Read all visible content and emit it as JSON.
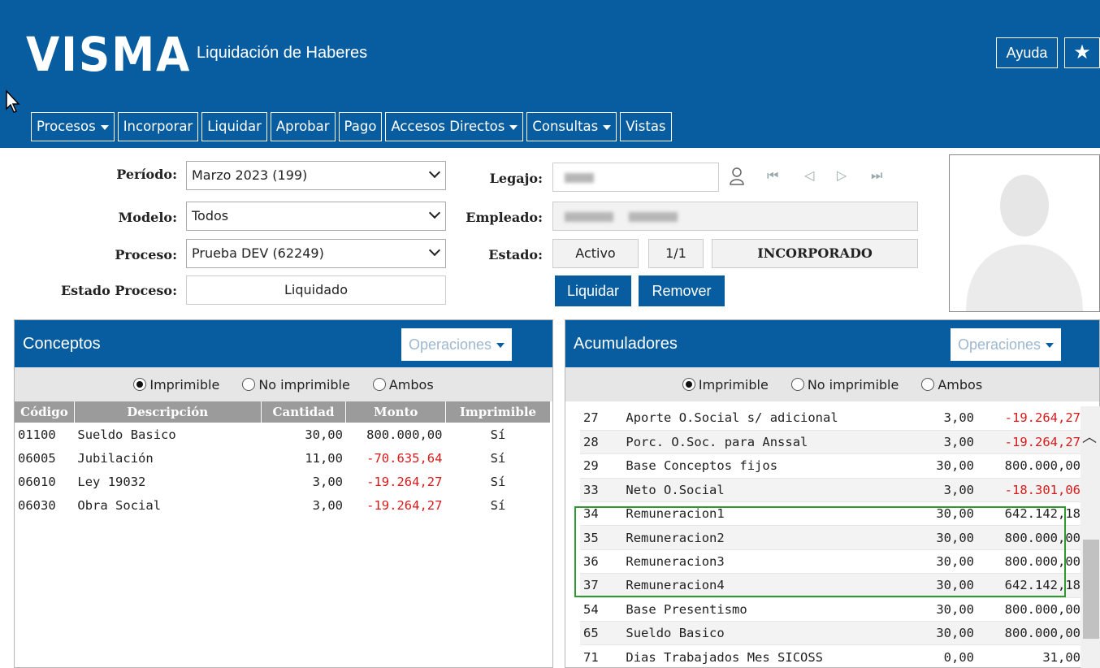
{
  "header": {
    "logo": "VISMA",
    "title": "Liquidación de Haberes",
    "help_label": "Ayuda",
    "star_icon": "★"
  },
  "menu": [
    {
      "label": "Procesos",
      "dropdown": true
    },
    {
      "label": "Incorporar",
      "dropdown": false
    },
    {
      "label": "Liquidar",
      "dropdown": false
    },
    {
      "label": "Aprobar",
      "dropdown": false
    },
    {
      "label": "Pago",
      "dropdown": false
    },
    {
      "label": "Accesos Directos",
      "dropdown": true
    },
    {
      "label": "Consultas",
      "dropdown": true
    },
    {
      "label": "Vistas",
      "dropdown": false
    }
  ],
  "form": {
    "periodo_label": "Período:",
    "periodo_value": "Marzo 2023 (199)",
    "modelo_label": "Modelo:",
    "modelo_value": "Todos",
    "proceso_label": "Proceso:",
    "proceso_value": "Prueba DEV (62249)",
    "estado_proceso_label": "Estado Proceso:",
    "estado_proceso_value": "Liquidado",
    "legajo_label": "Legajo:",
    "empleado_label": "Empleado:",
    "estado_label": "Estado:",
    "estado_value": "Activo",
    "estado_count": "1/1",
    "estado_status": "INCORPORADO",
    "liquidar_label": "Liquidar",
    "remover_label": "Remover"
  },
  "conceptos": {
    "title": "Conceptos",
    "operaciones_label": "Operaciones",
    "radios": [
      "Imprimible",
      "No imprimible",
      "Ambos"
    ],
    "selected_radio": "Imprimible",
    "columns": [
      "Código",
      "Descripción",
      "Cantidad",
      "Monto",
      "Imprimible"
    ],
    "rows": [
      {
        "code": "01100",
        "desc": "Sueldo Basico",
        "cant": "30,00",
        "monto": "800.000,00",
        "imp": "Sí"
      },
      {
        "code": "06005",
        "desc": "Jubilación",
        "cant": "11,00",
        "monto": "-70.635,64",
        "imp": "Sí"
      },
      {
        "code": "06010",
        "desc": "Ley 19032",
        "cant": "3,00",
        "monto": "-19.264,27",
        "imp": "Sí"
      },
      {
        "code": "06030",
        "desc": "Obra Social",
        "cant": "3,00",
        "monto": "-19.264,27",
        "imp": "Sí"
      }
    ]
  },
  "acumuladores": {
    "title": "Acumuladores",
    "operaciones_label": "Operaciones",
    "radios": [
      "Imprimible",
      "No imprimible",
      "Ambos"
    ],
    "selected_radio": "Imprimible",
    "rows": [
      {
        "code": "27",
        "desc": "Aporte O.Social s/ adicional",
        "cant": "3,00",
        "monto": "-19.264,27"
      },
      {
        "code": "28",
        "desc": "Porc. O.Soc. para Anssal",
        "cant": "3,00",
        "monto": "-19.264,27"
      },
      {
        "code": "29",
        "desc": "Base Conceptos fijos",
        "cant": "30,00",
        "monto": "800.000,00"
      },
      {
        "code": "33",
        "desc": "Neto O.Social",
        "cant": "3,00",
        "monto": "-18.301,06"
      },
      {
        "code": "34",
        "desc": "Remuneracion1",
        "cant": "30,00",
        "monto": "642.142,18"
      },
      {
        "code": "35",
        "desc": "Remuneracion2",
        "cant": "30,00",
        "monto": "800.000,00"
      },
      {
        "code": "36",
        "desc": "Remuneracion3",
        "cant": "30,00",
        "monto": "800.000,00"
      },
      {
        "code": "37",
        "desc": "Remuneracion4",
        "cant": "30,00",
        "monto": "642.142,18"
      },
      {
        "code": "54",
        "desc": "Base Presentismo",
        "cant": "30,00",
        "monto": "800.000,00"
      },
      {
        "code": "65",
        "desc": "Sueldo Basico",
        "cant": "30,00",
        "monto": "800.000,00"
      },
      {
        "code": "71",
        "desc": "Dias Trabajados Mes SICOSS",
        "cant": "0,00",
        "monto": "31,00"
      }
    ]
  },
  "colors": {
    "brand": "#075d9f",
    "negative": "#d81a1a",
    "highlight": "#2e9a2e"
  }
}
